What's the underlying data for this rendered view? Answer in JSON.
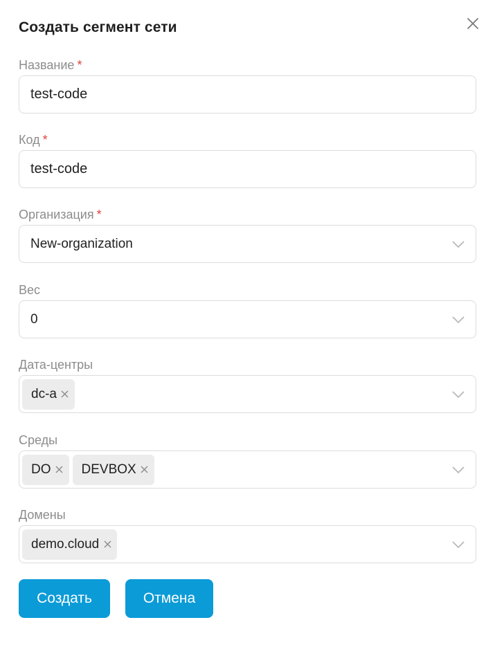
{
  "dialog": {
    "title": "Создать сегмент сети"
  },
  "fields": {
    "name": {
      "label": "Название",
      "required_mark": "*",
      "value": "test-code"
    },
    "code": {
      "label": "Код",
      "required_mark": "*",
      "value": "test-code"
    },
    "organization": {
      "label": "Организация",
      "required_mark": "*",
      "value": "New-organization"
    },
    "weight": {
      "label": "Вес",
      "value": "0"
    },
    "datacenters": {
      "label": "Дата-центры",
      "tags": [
        "dc-a"
      ]
    },
    "environments": {
      "label": "Среды",
      "tags": [
        "DO",
        "DEVBOX"
      ]
    },
    "domains": {
      "label": "Домены",
      "tags": [
        "demo.cloud"
      ]
    }
  },
  "buttons": {
    "create": "Создать",
    "cancel": "Отмена"
  },
  "icons": {
    "close": "close-icon",
    "chevron": "chevron-down-icon",
    "tag_remove": "close-icon"
  },
  "colors": {
    "primary": "#0b9bd7",
    "required": "#e0443a",
    "label": "#8c8c8c",
    "border": "#dcdcdc",
    "tag_bg": "#ececec"
  }
}
